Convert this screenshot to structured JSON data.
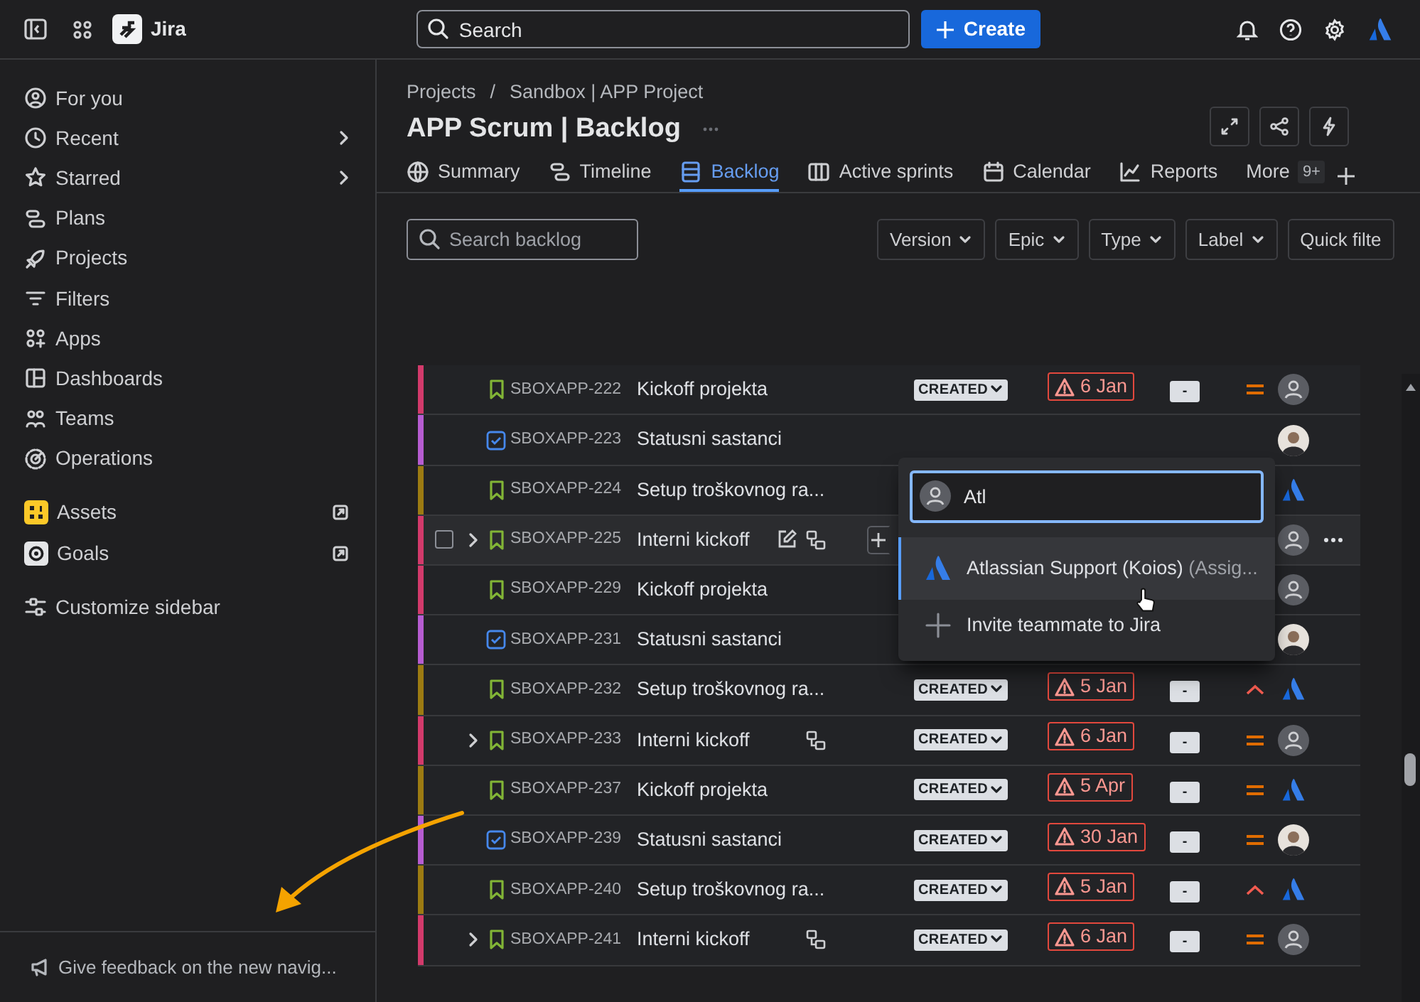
{
  "topbar": {
    "product": "Jira",
    "search": {
      "placeholder": "Search"
    },
    "create": "Create"
  },
  "sidebar": {
    "groups": [
      [
        {
          "label": "For you",
          "submenu": false,
          "external": false
        },
        {
          "label": "Recent",
          "submenu": true,
          "external": false
        },
        {
          "label": "Starred",
          "submenu": true,
          "external": false
        },
        {
          "label": "Plans",
          "submenu": false,
          "external": false
        },
        {
          "label": "Projects",
          "submenu": false,
          "external": false
        },
        {
          "label": "Filters",
          "submenu": false,
          "external": false
        },
        {
          "label": "Apps",
          "submenu": false,
          "external": false
        },
        {
          "label": "Dashboards",
          "submenu": false,
          "external": false
        },
        {
          "label": "Teams",
          "submenu": false,
          "external": false
        },
        {
          "label": "Operations",
          "submenu": false,
          "external": false
        }
      ],
      [
        {
          "label": "Assets",
          "submenu": false,
          "external": true
        },
        {
          "label": "Goals",
          "submenu": false,
          "external": true
        }
      ],
      [
        {
          "label": "Customize sidebar",
          "submenu": false,
          "external": false
        }
      ]
    ],
    "feedback": "Give feedback on the new navig..."
  },
  "breadcrumbs": {
    "items": [
      "Projects",
      "Sandbox | APP Project"
    ],
    "separator": "/"
  },
  "title": "APP Scrum | Backlog",
  "tabs": [
    {
      "label": "Summary",
      "selected": false
    },
    {
      "label": "Timeline",
      "selected": false
    },
    {
      "label": "Backlog",
      "selected": true
    },
    {
      "label": "Active sprints",
      "selected": false
    },
    {
      "label": "Calendar",
      "selected": false
    },
    {
      "label": "Reports",
      "selected": false
    },
    {
      "label": "More",
      "badge": "9+",
      "selected": false
    }
  ],
  "filters": {
    "search": {
      "placeholder": "Search backlog"
    },
    "buttons": [
      "Version",
      "Epic",
      "Type",
      "Label",
      "Quick filte"
    ]
  },
  "rows": [
    {
      "key": "SBOXAPP-222",
      "title": "Kickoff projekta",
      "kind": "story",
      "color": "#d23a6b",
      "expandable": false,
      "hovered": false,
      "status": "CREATED",
      "due": "6 Jan",
      "points": "-",
      "priority_high": false,
      "assignee": {
        "kind": "default"
      }
    },
    {
      "key": "SBOXAPP-223",
      "title": "Statusni sastanci",
      "kind": "task",
      "color": "#b65cd1",
      "expandable": false,
      "hovered": false,
      "assignee": {
        "kind": "photo"
      }
    },
    {
      "key": "SBOXAPP-224",
      "title": "Setup troškovnog ra...",
      "kind": "story",
      "color": "#9c7b12",
      "expandable": false,
      "hovered": false,
      "assignee": {
        "kind": "atlassian"
      }
    },
    {
      "key": "SBOXAPP-225",
      "title": "Interni kickoff",
      "kind": "story",
      "color": "#d23a6b",
      "expandable": true,
      "hovered": true,
      "assignee": {
        "kind": "default"
      }
    },
    {
      "key": "SBOXAPP-229",
      "title": "Kickoff projekta",
      "kind": "story",
      "color": "#d23a6b",
      "expandable": false,
      "hovered": false,
      "assignee": {
        "kind": "default"
      }
    },
    {
      "key": "SBOXAPP-231",
      "title": "Statusni sastanci",
      "kind": "task",
      "color": "#b65cd1",
      "expandable": false,
      "hovered": false,
      "assignee": {
        "kind": "photo"
      }
    },
    {
      "key": "SBOXAPP-232",
      "title": "Setup troškovnog ra...",
      "kind": "story",
      "color": "#9c7b12",
      "expandable": false,
      "hovered": false,
      "status": "CREATED",
      "due": "5 Jan",
      "points": "-",
      "priority_high": true,
      "assignee": {
        "kind": "atlassian"
      }
    },
    {
      "key": "SBOXAPP-233",
      "title": "Interni kickoff",
      "kind": "story",
      "color": "#d23a6b",
      "expandable": true,
      "hovered": false,
      "status": "CREATED",
      "due": "6 Jan",
      "points": "-",
      "priority_high": false,
      "assignee": {
        "kind": "default"
      }
    },
    {
      "key": "SBOXAPP-237",
      "title": "Kickoff projekta",
      "kind": "story",
      "color": "#9c7b12",
      "expandable": false,
      "hovered": false,
      "status": "CREATED",
      "due": "5 Apr",
      "points": "-",
      "priority_high": false,
      "assignee": {
        "kind": "atlassian"
      }
    },
    {
      "key": "SBOXAPP-239",
      "title": "Statusni sastanci",
      "kind": "task",
      "color": "#b65cd1",
      "expandable": false,
      "hovered": false,
      "status": "CREATED",
      "due": "30 Jan",
      "points": "-",
      "priority_high": false,
      "assignee": {
        "kind": "photo"
      }
    },
    {
      "key": "SBOXAPP-240",
      "title": "Setup troškovnog ra...",
      "kind": "story",
      "color": "#9c7b12",
      "expandable": false,
      "hovered": false,
      "status": "CREATED",
      "due": "5 Jan",
      "points": "-",
      "priority_high": true,
      "assignee": {
        "kind": "atlassian"
      }
    },
    {
      "key": "SBOXAPP-241",
      "title": "Interni kickoff",
      "kind": "story",
      "color": "#d23a6b",
      "expandable": true,
      "hovered": false,
      "status": "CREATED",
      "due": "6 Jan",
      "points": "-",
      "priority_high": false,
      "assignee": {
        "kind": "default"
      }
    }
  ],
  "assignee_picker": {
    "query": "Atl",
    "options": [
      {
        "kind": "user",
        "label": "Atlassian Support (Koios)",
        "hint": "(Assig...",
        "selected": true
      },
      {
        "kind": "invite",
        "label": "Invite teammate to Jira",
        "selected": false
      }
    ]
  }
}
